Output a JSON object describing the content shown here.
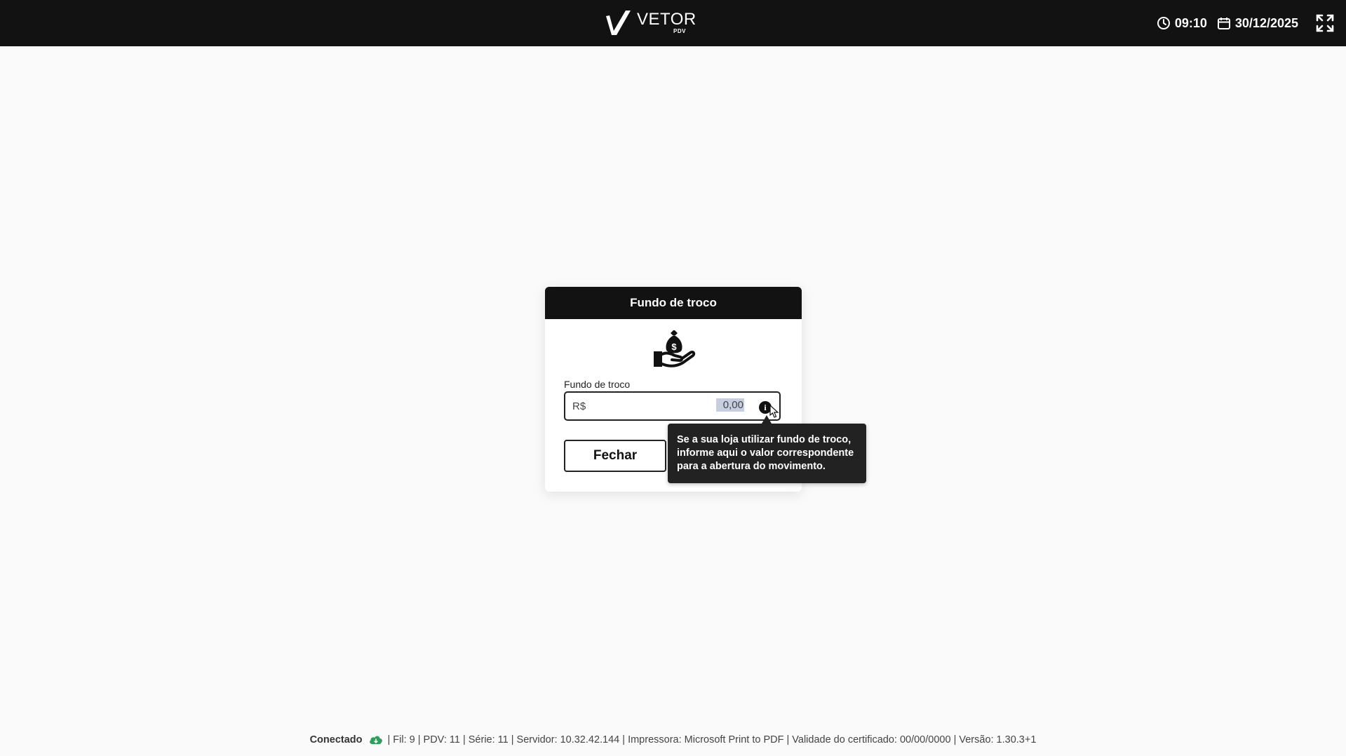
{
  "header": {
    "logo_name": "VETOR",
    "logo_sub": "PDV",
    "time": "09:10",
    "date": "30/12/2025"
  },
  "modal": {
    "title": "Fundo de troco",
    "field_label": "Fundo de troco",
    "currency": "R$",
    "amount_value": "0,00",
    "info_glyph": "i",
    "close_label": "Fechar"
  },
  "tooltip": {
    "lines": [
      "Se a sua loja utilizar fundo de troco,",
      "informe aqui o valor correspondente",
      "para a abertura do movimento."
    ]
  },
  "status": {
    "connection": "Conectado",
    "details": "| Fil: 9 | PDV: 11 | Série: 11 | Servidor: 10.32.42.144 | Impressora: Microsoft Print to PDF | Validade do certificado: 00/00/0000 | Versão: 1.30.3+1"
  },
  "colors": {
    "header_bg": "#121212",
    "cloud_green": "#2e9e5b",
    "selection": "#c6cfe0"
  },
  "icons": {
    "logo": "vetor-v-logo",
    "clock": "clock-icon",
    "calendar": "calendar-icon",
    "expand": "fullscreen-icon",
    "money": "hand-money-bag-icon",
    "info": "info-icon",
    "cloud": "cloud-sync-icon"
  }
}
